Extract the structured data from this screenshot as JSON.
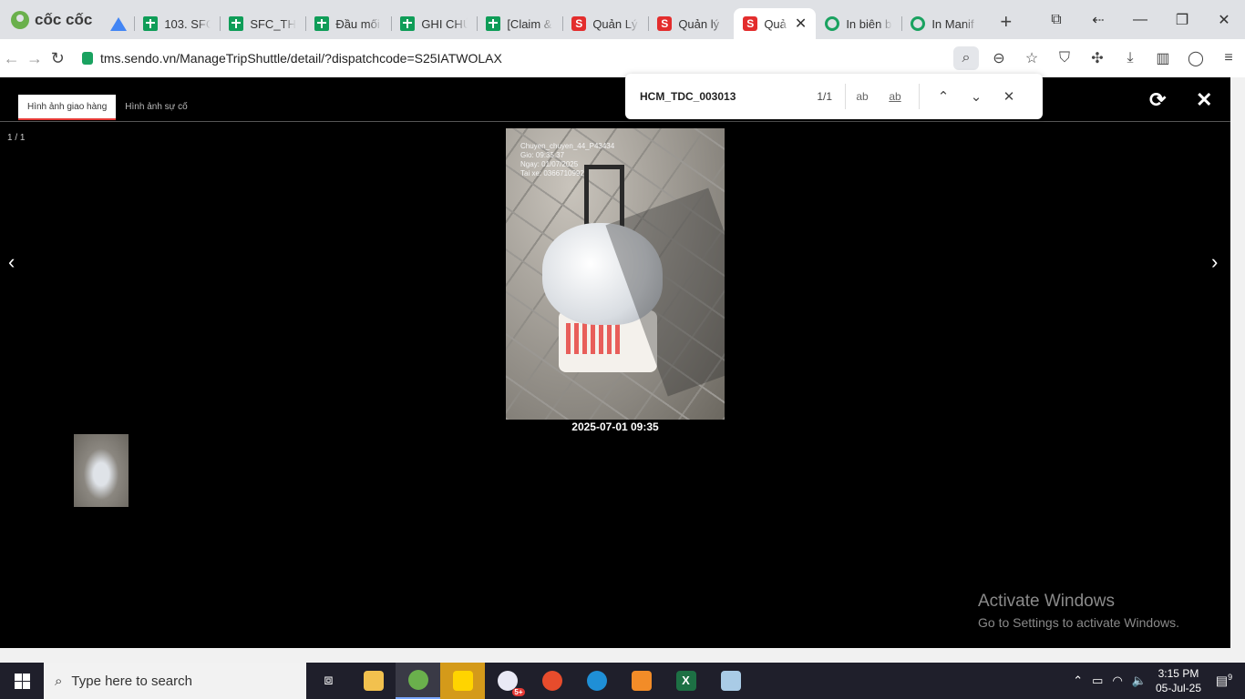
{
  "browser": {
    "brand": "cốc cốc",
    "tabs": [
      {
        "title": "",
        "favicon": "google-drive-icon",
        "kind": "drive"
      },
      {
        "title": "103. SFC",
        "favicon": "google-sheets-icon",
        "kind": "sheet"
      },
      {
        "title": "SFC_THE",
        "favicon": "google-sheets-icon",
        "kind": "sheet"
      },
      {
        "title": "Đầu mối",
        "favicon": "google-sheets-icon",
        "kind": "sheet"
      },
      {
        "title": "GHI CHÚ",
        "favicon": "google-sheets-icon",
        "kind": "sheet"
      },
      {
        "title": "[Claim &",
        "favicon": "google-sheets-icon",
        "kind": "sheet"
      },
      {
        "title": "Quản Lý",
        "favicon": "sendo-icon",
        "kind": "sendo"
      },
      {
        "title": "Quản lý",
        "favicon": "sendo-icon",
        "kind": "sendo"
      },
      {
        "title": "Quả",
        "favicon": "sendo-icon",
        "kind": "sendo",
        "active": true
      },
      {
        "title": "In biên b",
        "favicon": "green-circle-icon",
        "kind": "green"
      },
      {
        "title": "In Manif",
        "favicon": "green-circle-icon",
        "kind": "green"
      }
    ],
    "url": "tms.sendo.vn/ManageTripShuttle/detail/?dispatchcode=S25IATWOLAX"
  },
  "viewer": {
    "tabs": [
      "Hình ảnh giao hàng",
      "Hình ảnh sự cố"
    ],
    "counter": "1 / 1",
    "photo_stamp": [
      "Chuyen_chuyen_44_P43434",
      "Gio: 09:35:37",
      "Ngay: 01/07/2025",
      "Tai xe: 0366710992"
    ],
    "caption": "2025-07-01 09:35",
    "prev": "‹",
    "next": "›"
  },
  "find_bar": {
    "query": "HCM_TDC_003013",
    "count": "1/1",
    "match_case": "ab",
    "whole_word": "ab"
  },
  "watermark": {
    "line1": "Activate Windows",
    "line2": "Go to Settings to activate Windows."
  },
  "taskbar": {
    "search_placeholder": "Type here to search",
    "time": "3:15 PM",
    "date": "05-Jul-25",
    "notifications": "9",
    "zalo_badge": "5+"
  },
  "colors": {
    "accent_red": "#e53935",
    "sheets_green": "#0f9d58",
    "sendo_red": "#e32d2d"
  }
}
